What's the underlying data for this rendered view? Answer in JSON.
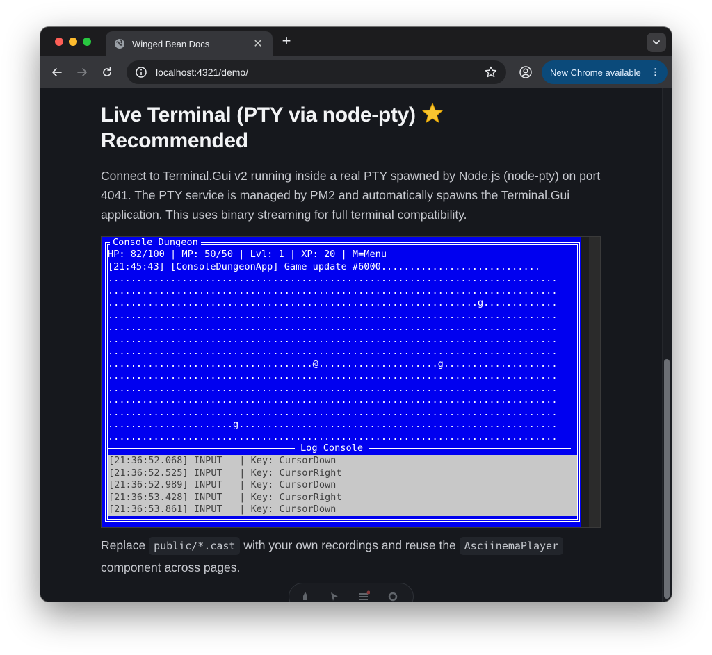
{
  "browser": {
    "tab": {
      "title": "Winged Bean Docs"
    },
    "new_tab_label": "+",
    "address": {
      "url": "localhost:4321/demo/"
    },
    "update_button": {
      "label": "New Chrome available"
    }
  },
  "page": {
    "heading": "Live Terminal (PTY via node-pty) ",
    "heading_line2": "Recommended",
    "heading_icon": "star-icon",
    "intro": "Connect to Terminal.Gui v2 running inside a real PTY spawned by Node.js (node-pty) on port 4041. The PTY service is managed by PM2 and automatically spawns the Terminal.Gui application. This uses binary streaming for full terminal compatibility.",
    "outro": {
      "before": "Replace ",
      "code1": "public/*.cast",
      "middle": " with your own recordings and reuse the ",
      "code2": "AsciinemaPlayer",
      "after": " component across pages."
    }
  },
  "terminal": {
    "window_title": "Console Dungeon",
    "status": "HP: 82/100 | MP: 50/50 | Lvl: 1 | XP: 20 | M=Menu",
    "map_rows": [
      "[21:45:43] [ConsoleDungeonApp] Game update #6000............................",
      "...............................................................................",
      "...............................................................................",
      ".................................................................g.............",
      "...............................................................................",
      "...............................................................................",
      "...............................................................................",
      "...............................................................................",
      "....................................@.....................g....................",
      "...............................................................................",
      "...............................................................................",
      "...............................................................................",
      "...............................................................................",
      "......................g........................................................",
      "..............................................................................."
    ],
    "log_title": "Log Console",
    "log_rows": [
      "[21:36:52.068] INPUT   | Key: CursorDown",
      "[21:36:52.525] INPUT   | Key: CursorRight",
      "[21:36:52.989] INPUT   | Key: CursorDown",
      "[21:36:53.428] INPUT   | Key: CursorRight",
      "[21:36:53.861] INPUT   | Key: CursorDown"
    ],
    "colors": {
      "background": "#0000f0",
      "log_background": "#c8c8c8"
    }
  }
}
